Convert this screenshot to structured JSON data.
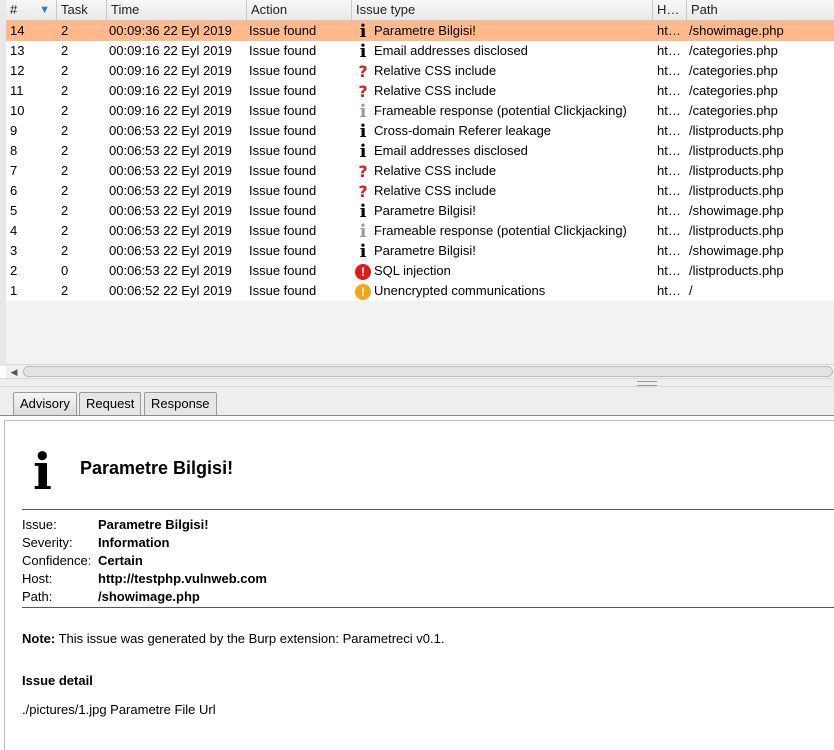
{
  "table": {
    "columns": [
      "#",
      "Task",
      "Time",
      "Action",
      "Issue type",
      "H…",
      "Path"
    ],
    "sort_indicator": "▼",
    "rows": [
      {
        "num": "14",
        "task": "2",
        "time": "00:09:36 22 Eyl 2019",
        "action": "Issue found",
        "icon": "info",
        "issue": "Parametre Bilgisi!",
        "host": "ht…",
        "path": "/showimage.php",
        "selected": true
      },
      {
        "num": "13",
        "task": "2",
        "time": "00:09:16 22 Eyl 2019",
        "action": "Issue found",
        "icon": "info",
        "issue": "Email addresses disclosed",
        "host": "ht…",
        "path": "/categories.php"
      },
      {
        "num": "12",
        "task": "2",
        "time": "00:09:16 22 Eyl 2019",
        "action": "Issue found",
        "icon": "question",
        "issue": "Relative CSS include",
        "host": "ht…",
        "path": "/categories.php"
      },
      {
        "num": "11",
        "task": "2",
        "time": "00:09:16 22 Eyl 2019",
        "action": "Issue found",
        "icon": "question",
        "issue": "Relative CSS include",
        "host": "ht…",
        "path": "/categories.php"
      },
      {
        "num": "10",
        "task": "2",
        "time": "00:09:16 22 Eyl 2019",
        "action": "Issue found",
        "icon": "info-grey",
        "issue": "Frameable response (potential Clickjacking)",
        "host": "ht…",
        "path": "/categories.php"
      },
      {
        "num": "9",
        "task": "2",
        "time": "00:06:53 22 Eyl 2019",
        "action": "Issue found",
        "icon": "info",
        "issue": "Cross-domain Referer leakage",
        "host": "ht…",
        "path": "/listproducts.php"
      },
      {
        "num": "8",
        "task": "2",
        "time": "00:06:53 22 Eyl 2019",
        "action": "Issue found",
        "icon": "info",
        "issue": "Email addresses disclosed",
        "host": "ht…",
        "path": "/listproducts.php"
      },
      {
        "num": "7",
        "task": "2",
        "time": "00:06:53 22 Eyl 2019",
        "action": "Issue found",
        "icon": "question",
        "issue": "Relative CSS include",
        "host": "ht…",
        "path": "/listproducts.php"
      },
      {
        "num": "6",
        "task": "2",
        "time": "00:06:53 22 Eyl 2019",
        "action": "Issue found",
        "icon": "question",
        "issue": "Relative CSS include",
        "host": "ht…",
        "path": "/listproducts.php"
      },
      {
        "num": "5",
        "task": "2",
        "time": "00:06:53 22 Eyl 2019",
        "action": "Issue found",
        "icon": "info",
        "issue": "Parametre Bilgisi!",
        "host": "ht…",
        "path": "/showimage.php"
      },
      {
        "num": "4",
        "task": "2",
        "time": "00:06:53 22 Eyl 2019",
        "action": "Issue found",
        "icon": "info-grey",
        "issue": "Frameable response (potential Clickjacking)",
        "host": "ht…",
        "path": "/listproducts.php"
      },
      {
        "num": "3",
        "task": "2",
        "time": "00:06:53 22 Eyl 2019",
        "action": "Issue found",
        "icon": "info",
        "issue": "Parametre Bilgisi!",
        "host": "ht…",
        "path": "/showimage.php"
      },
      {
        "num": "2",
        "task": "0",
        "time": "00:06:53 22 Eyl 2019",
        "action": "Issue found",
        "icon": "high",
        "issue": "SQL injection",
        "host": "ht…",
        "path": "/listproducts.php"
      },
      {
        "num": "1",
        "task": "2",
        "time": "00:06:52 22 Eyl 2019",
        "action": "Issue found",
        "icon": "warning",
        "issue": "Unencrypted communications",
        "host": "ht…",
        "path": "/"
      }
    ]
  },
  "tabs": [
    {
      "label": "Advisory",
      "active": true
    },
    {
      "label": "Request",
      "active": false
    },
    {
      "label": "Response",
      "active": false
    }
  ],
  "advisory": {
    "icon_glyph": "i",
    "title": "Parametre Bilgisi!",
    "fields": [
      {
        "label": "Issue:",
        "value": "Parametre Bilgisi!"
      },
      {
        "label": "Severity:",
        "value": "Information"
      },
      {
        "label": "Confidence:",
        "value": "Certain"
      },
      {
        "label": "Host:",
        "value": "http://testphp.vulnweb.com"
      },
      {
        "label": "Path:",
        "value": "/showimage.php"
      }
    ],
    "note_label": "Note:",
    "note_text": " This issue was generated by the Burp extension: Parametreci v0.1.",
    "detail_heading": "Issue detail",
    "detail_text": "./pictures/1.jpg Parametre File Url"
  },
  "colors": {
    "selected_row": "#ffb98a",
    "high_severity": "#e21a1a",
    "medium_severity": "#f3a712",
    "question_mark": "#d91e18"
  }
}
